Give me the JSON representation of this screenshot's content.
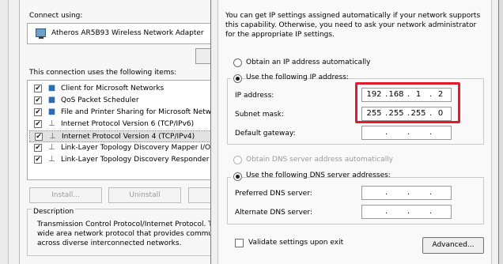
{
  "back_window": {
    "connect_using_label": "Connect using:",
    "adapter_name": "Atheros AR5B93 Wireless Network Adapter",
    "items_label": "This connection uses the following items:",
    "items": [
      {
        "label": "Client for Microsoft Networks",
        "icon": "network-client-icon",
        "checked": true
      },
      {
        "label": "QoS Packet Scheduler",
        "icon": "service-icon",
        "checked": true
      },
      {
        "label": "File and Printer Sharing for Microsoft Netwo",
        "icon": "service-icon",
        "checked": true
      },
      {
        "label": "Internet Protocol Version 6 (TCP/IPv6)",
        "icon": "protocol-icon",
        "checked": true
      },
      {
        "label": "Internet Protocol Version 4 (TCP/IPv4)",
        "icon": "protocol-icon",
        "checked": true,
        "selected": true
      },
      {
        "label": "Link-Layer Topology Discovery Mapper I/O",
        "icon": "protocol-icon",
        "checked": true
      },
      {
        "label": "Link-Layer Topology Discovery Responder",
        "icon": "protocol-icon",
        "checked": true
      }
    ],
    "install_label": "Install...",
    "uninstall_label": "Uninstall",
    "description_legend": "Description",
    "description_lines": [
      "Transmission Control Protocol/Internet Protocol. T",
      "wide area network protocol that provides commun",
      "across diverse interconnected networks."
    ]
  },
  "ipv4_dialog": {
    "intro_lines": [
      "You can get IP settings assigned automatically if your network supports",
      "this capability. Otherwise, you need to ask your network administrator",
      "for the appropriate IP settings."
    ],
    "obtain_ip_auto_label": "Obtain an IP address automatically",
    "use_following_ip_label": "Use the following IP address:",
    "ip_address_label": "IP address:",
    "ip_address": [
      "192",
      "168",
      "1",
      "2"
    ],
    "subnet_mask_label": "Subnet mask:",
    "subnet_mask": [
      "255",
      "255",
      "255",
      "0"
    ],
    "default_gateway_label": "Default gateway:",
    "obtain_dns_auto_label": "Obtain DNS server address automatically",
    "use_following_dns_label": "Use the following DNS server addresses:",
    "preferred_dns_label": "Preferred DNS server:",
    "alternate_dns_label": "Alternate DNS server:",
    "validate_label": "Validate settings upon exit",
    "advanced_label": "Advanced...",
    "highlight_color": "#e21b2a"
  }
}
